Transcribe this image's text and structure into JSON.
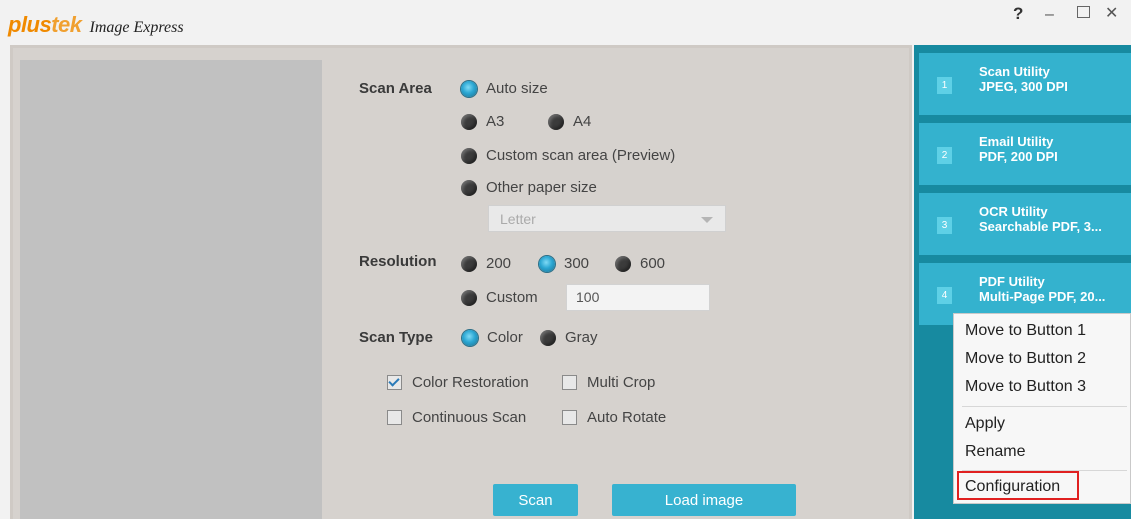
{
  "app": {
    "brand_plus": "plus",
    "brand_tek": "tek",
    "name": "Image Express"
  },
  "window_controls": {
    "help": "?",
    "minimize": "–",
    "close": "✕"
  },
  "scan_area": {
    "label": "Scan Area",
    "auto_size": "Auto size",
    "a3": "A3",
    "a4": "A4",
    "custom_area": "Custom scan area (Preview)",
    "other_paper": "Other paper size",
    "paper_select_value": "Letter",
    "selected": "Auto size"
  },
  "resolution": {
    "label": "Resolution",
    "r200": "200",
    "r300": "300",
    "r600": "600",
    "custom": "Custom",
    "custom_value": "100",
    "selected": "300"
  },
  "scan_type": {
    "label": "Scan Type",
    "color": "Color",
    "gray": "Gray",
    "selected": "Color"
  },
  "options": {
    "color_restoration": "Color Restoration",
    "multi_crop": "Multi Crop",
    "continuous_scan": "Continuous Scan",
    "auto_rotate": "Auto Rotate",
    "color_restoration_checked": true
  },
  "buttons": {
    "scan": "Scan",
    "load_image": "Load image"
  },
  "utilities": [
    {
      "num": "1",
      "name": "Scan Utility",
      "detail": "JPEG, 300 DPI"
    },
    {
      "num": "2",
      "name": "Email Utility",
      "detail": "PDF, 200 DPI"
    },
    {
      "num": "3",
      "name": "OCR Utility",
      "detail": "Searchable PDF, 3..."
    },
    {
      "num": "4",
      "name": "PDF Utility",
      "detail": "Multi-Page PDF, 20..."
    }
  ],
  "context_menu": {
    "move1": "Move to Button 1",
    "move2": "Move to Button 2",
    "move3": "Move to Button 3",
    "apply": "Apply",
    "rename": "Rename",
    "configuration": "Configuration"
  },
  "colors": {
    "accent": "#34b2ce",
    "panel_dark": "#178aa0",
    "highlight_border": "#e02020",
    "brand_orange": "#f08a00"
  }
}
